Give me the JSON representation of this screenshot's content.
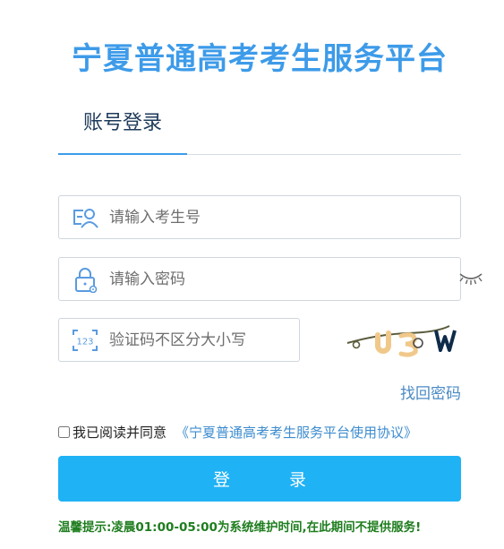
{
  "header": {
    "title": "宁夏普通高考考生服务平台"
  },
  "tabs": [
    {
      "label": "账号登录",
      "active": true
    }
  ],
  "form": {
    "username": {
      "placeholder": "请输入考生号",
      "value": ""
    },
    "password": {
      "placeholder": "请输入密码",
      "value": ""
    },
    "captcha": {
      "placeholder": "验证码不区分大小写",
      "value": ""
    },
    "captcha_image_text": "U3 W"
  },
  "links": {
    "forgot_password": "找回密码"
  },
  "agreement": {
    "text": "我已阅读并同意",
    "link": "《宁夏普通高考考生服务平台使用协议》",
    "checked": false
  },
  "buttons": {
    "login": "登 录"
  },
  "notice": "温馨提示:凌晨01:00-05:00为系统维护时间,在此期间不提供服务!",
  "colors": {
    "brand": "#3d9be9",
    "button": "#1fb2f5",
    "notice": "#1e7d1e",
    "link": "#3d8ccf"
  },
  "icons": {
    "username": "user-card-icon",
    "password": "lock-gear-icon",
    "captcha": "number-123-icon",
    "toggle": "eye-closed-icon"
  }
}
